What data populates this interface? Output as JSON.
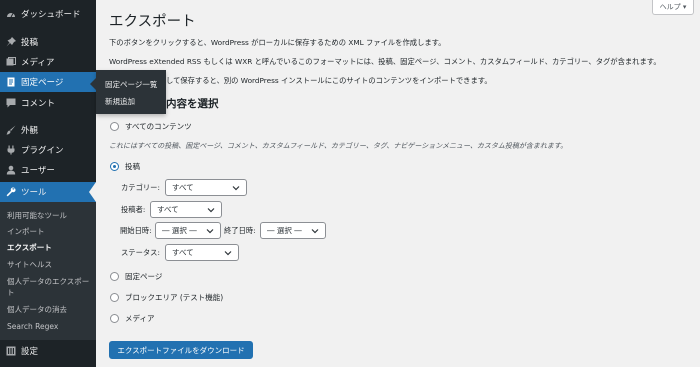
{
  "sidebar": {
    "items": [
      {
        "label": "ダッシュボード",
        "icon": "dashboard-icon"
      },
      {
        "label": "投稿",
        "icon": "pin-icon"
      },
      {
        "label": "メディア",
        "icon": "media-icon"
      },
      {
        "label": "固定ページ",
        "icon": "pages-icon"
      },
      {
        "label": "コメント",
        "icon": "comment-icon"
      },
      {
        "label": "外観",
        "icon": "brush-icon"
      },
      {
        "label": "プラグイン",
        "icon": "plugin-icon"
      },
      {
        "label": "ユーザー",
        "icon": "user-icon"
      },
      {
        "label": "ツール",
        "icon": "wrench-icon"
      },
      {
        "label": "設定",
        "icon": "settings-icon"
      }
    ],
    "tools_submenu": [
      "利用可能なツール",
      "インポート",
      "エクスポート",
      "サイトヘルス",
      "個人データのエクスポート",
      "個人データの消去",
      "Search Regex"
    ]
  },
  "flyout": {
    "items": [
      "固定ページ一覧",
      "新規追加"
    ]
  },
  "header": {
    "help": "ヘルプ ▾"
  },
  "main": {
    "title": "エクスポート",
    "paragraphs": [
      "下のボタンをクリックすると、WordPress がローカルに保存するための XML ファイルを作成します。",
      "WordPress eXtended RSS もしくは WXR と呼んでいるこのフォーマットには、投稿、固定ページ、コメント、カスタムフィールド、カテゴリー、タグが含まれます。",
      "して保存すると、別の WordPress インストールにこのサイトのコンテンツをインポートできます。"
    ],
    "section_heading": "内容を選択",
    "options": {
      "all": "すべてのコンテンツ",
      "all_note": "これにはすべての投稿、固定ページ、コメント、カスタムフィールド、カテゴリー、タグ、ナビゲーションメニュー、カスタム投稿が含まれます。",
      "posts": "投稿",
      "pages": "固定ページ",
      "block": "ブロックエリア (テスト機能)",
      "media": "メディア"
    },
    "filters": {
      "category_label": "カテゴリー:",
      "category_value": "すべて",
      "author_label": "投稿者:",
      "author_value": "すべて",
      "start_label": "開始日時:",
      "start_value": "― 選択 ―",
      "end_label": "終了日時:",
      "end_value": "― 選択 ―",
      "status_label": "ステータス:",
      "status_value": "すべて"
    },
    "download_button": "エクスポートファイルをダウンロード"
  },
  "colors": {
    "sidebar_bg": "#1d2327",
    "accent": "#2271b1",
    "page_bg": "#f1f1f1"
  }
}
